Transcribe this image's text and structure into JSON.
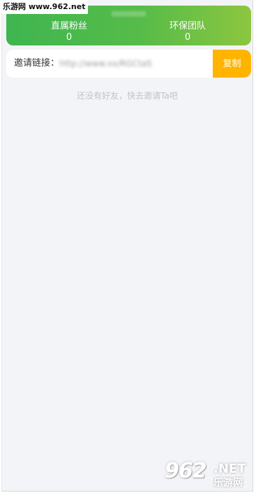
{
  "watermark": {
    "top_left": "乐游网 www.962.net",
    "bottom_right_number": "962",
    "bottom_right_net": ".NET",
    "bottom_right_cn": "乐游网"
  },
  "stats": {
    "user_name_blurred": "XXXXXXXX",
    "left": {
      "label": "直属粉丝",
      "value": "0"
    },
    "right": {
      "label": "环保团队",
      "value": "0"
    }
  },
  "invite": {
    "label": "邀请链接：",
    "link_blurred": "http://www.xx/RGCtaS",
    "copy_button": "复制"
  },
  "empty_state": "还没有好友，快去邀请Ta吧",
  "colors": {
    "card_gradient_start": "#3fb550",
    "card_gradient_end": "#8cc63f",
    "copy_button": "#ffb400",
    "background": "#f3f4f8"
  }
}
